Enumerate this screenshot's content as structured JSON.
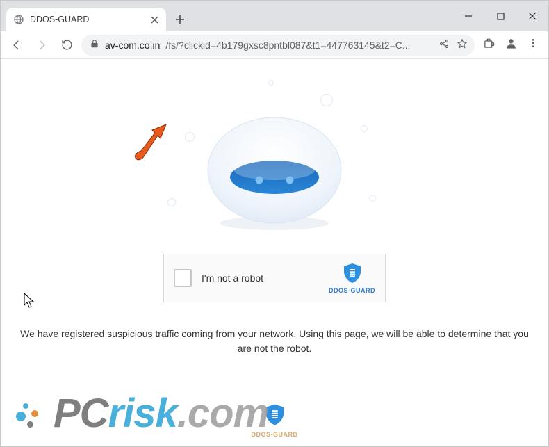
{
  "window": {
    "min_tooltip": "Minimize",
    "max_tooltip": "Maximize",
    "close_tooltip": "Close"
  },
  "tab": {
    "title": "DDOS-GUARD",
    "close_tooltip": "Close tab",
    "newtab_tooltip": "New tab"
  },
  "toolbar": {
    "back_tooltip": "Back",
    "forward_tooltip": "Forward",
    "reload_tooltip": "Reload",
    "secure_tooltip": "Secure",
    "share_tooltip": "Share",
    "bookmark_tooltip": "Bookmark",
    "extensions_tooltip": "Extensions",
    "profile_tooltip": "Profile",
    "menu_tooltip": "Menu"
  },
  "url": {
    "domain": "av-com.co.in",
    "path": "/fs/?clickid=4b179gxsc8pntbl087&t1=447763145&t2=C..."
  },
  "captcha": {
    "label": "I'm not a robot",
    "brand": "DDOS-GUARD"
  },
  "notice": "We have registered suspicious traffic coming from your network. Using this page, we will be able to determine that you are not the robot.",
  "midbrand": "DDOS-GUARD",
  "watermark": {
    "pc": "PC",
    "risk": "risk",
    "dom": ".com"
  },
  "colors": {
    "accent_blue": "#2a7bd4",
    "shield_blue": "#2d8fe0",
    "arrow_orange": "#e65a1c"
  }
}
